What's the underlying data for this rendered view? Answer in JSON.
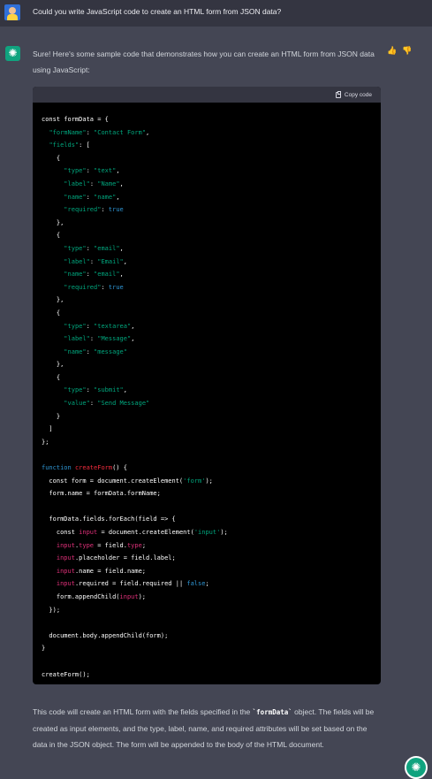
{
  "user": {
    "message": "Could you write JavaScript code to create an HTML form from JSON data?"
  },
  "assistant": {
    "intro": "Sure! Here's some sample code that demonstrates how you can create an HTML form from JSON data using JavaScript:",
    "copy_label": "Copy code",
    "outro_before": "This code will create an HTML form with the fields specified in the ",
    "outro_code": "`formData`",
    "outro_after": " object. The fields will be created as input elements, and the type, label, name, and required attributes will be set based on the data in the JSON object. The form will be appended to the body of the HTML document."
  },
  "code_lines": [
    [
      [
        "t",
        "const formData = {"
      ]
    ],
    [
      [
        "t",
        "  "
      ],
      [
        "s",
        "\"formName\""
      ],
      [
        "t",
        ": "
      ],
      [
        "s",
        "\"Contact Form\""
      ],
      [
        "t",
        ","
      ]
    ],
    [
      [
        "t",
        "  "
      ],
      [
        "s",
        "\"fields\""
      ],
      [
        "t",
        ": ["
      ]
    ],
    [
      [
        "t",
        "    {"
      ]
    ],
    [
      [
        "t",
        "      "
      ],
      [
        "s",
        "\"type\""
      ],
      [
        "t",
        ": "
      ],
      [
        "s",
        "\"text\""
      ],
      [
        "t",
        ","
      ]
    ],
    [
      [
        "t",
        "      "
      ],
      [
        "s",
        "\"label\""
      ],
      [
        "t",
        ": "
      ],
      [
        "s",
        "\"Name\""
      ],
      [
        "t",
        ","
      ]
    ],
    [
      [
        "t",
        "      "
      ],
      [
        "s",
        "\"name\""
      ],
      [
        "t",
        ": "
      ],
      [
        "s",
        "\"name\""
      ],
      [
        "t",
        ","
      ]
    ],
    [
      [
        "t",
        "      "
      ],
      [
        "s",
        "\"required\""
      ],
      [
        "t",
        ": "
      ],
      [
        "k",
        "true"
      ]
    ],
    [
      [
        "t",
        "    },"
      ]
    ],
    [
      [
        "t",
        "    {"
      ]
    ],
    [
      [
        "t",
        "      "
      ],
      [
        "s",
        "\"type\""
      ],
      [
        "t",
        ": "
      ],
      [
        "s",
        "\"email\""
      ],
      [
        "t",
        ","
      ]
    ],
    [
      [
        "t",
        "      "
      ],
      [
        "s",
        "\"label\""
      ],
      [
        "t",
        ": "
      ],
      [
        "s",
        "\"Email\""
      ],
      [
        "t",
        ","
      ]
    ],
    [
      [
        "t",
        "      "
      ],
      [
        "s",
        "\"name\""
      ],
      [
        "t",
        ": "
      ],
      [
        "s",
        "\"email\""
      ],
      [
        "t",
        ","
      ]
    ],
    [
      [
        "t",
        "      "
      ],
      [
        "s",
        "\"required\""
      ],
      [
        "t",
        ": "
      ],
      [
        "k",
        "true"
      ]
    ],
    [
      [
        "t",
        "    },"
      ]
    ],
    [
      [
        "t",
        "    {"
      ]
    ],
    [
      [
        "t",
        "      "
      ],
      [
        "s",
        "\"type\""
      ],
      [
        "t",
        ": "
      ],
      [
        "s",
        "\"textarea\""
      ],
      [
        "t",
        ","
      ]
    ],
    [
      [
        "t",
        "      "
      ],
      [
        "s",
        "\"label\""
      ],
      [
        "t",
        ": "
      ],
      [
        "s",
        "\"Message\""
      ],
      [
        "t",
        ","
      ]
    ],
    [
      [
        "t",
        "      "
      ],
      [
        "s",
        "\"name\""
      ],
      [
        "t",
        ": "
      ],
      [
        "s",
        "\"message\""
      ]
    ],
    [
      [
        "t",
        "    },"
      ]
    ],
    [
      [
        "t",
        "    {"
      ]
    ],
    [
      [
        "t",
        "      "
      ],
      [
        "s",
        "\"type\""
      ],
      [
        "t",
        ": "
      ],
      [
        "s",
        "\"submit\""
      ],
      [
        "t",
        ","
      ]
    ],
    [
      [
        "t",
        "      "
      ],
      [
        "s",
        "\"value\""
      ],
      [
        "t",
        ": "
      ],
      [
        "s",
        "\"Send Message\""
      ]
    ],
    [
      [
        "t",
        "    }"
      ]
    ],
    [
      [
        "t",
        "  ]"
      ]
    ],
    [
      [
        "t",
        "};"
      ]
    ],
    [
      [
        "t",
        ""
      ]
    ],
    [
      [
        "k",
        "function"
      ],
      [
        "t",
        " "
      ],
      [
        "f",
        "createForm"
      ],
      [
        "t",
        "() {"
      ]
    ],
    [
      [
        "t",
        "  const form = document.createElement("
      ],
      [
        "s",
        "'form'"
      ],
      [
        "t",
        ");"
      ]
    ],
    [
      [
        "t",
        "  form.name = formData.formName;"
      ]
    ],
    [
      [
        "t",
        ""
      ]
    ],
    [
      [
        "t",
        "  formData.fields.forEach(field => {"
      ]
    ],
    [
      [
        "t",
        "    const "
      ],
      [
        "v",
        "input"
      ],
      [
        "t",
        " = document.createElement("
      ],
      [
        "s",
        "'input'"
      ],
      [
        "t",
        ");"
      ]
    ],
    [
      [
        "t",
        "    "
      ],
      [
        "v",
        "input"
      ],
      [
        "t",
        "."
      ],
      [
        "v",
        "type"
      ],
      [
        "t",
        " = field."
      ],
      [
        "v",
        "type"
      ],
      [
        "t",
        ";"
      ]
    ],
    [
      [
        "t",
        "    "
      ],
      [
        "v",
        "input"
      ],
      [
        "t",
        ".placeholder = field.label;"
      ]
    ],
    [
      [
        "t",
        "    "
      ],
      [
        "v",
        "input"
      ],
      [
        "t",
        ".name = field.name;"
      ]
    ],
    [
      [
        "t",
        "    "
      ],
      [
        "v",
        "input"
      ],
      [
        "t",
        ".required = field.required || "
      ],
      [
        "k",
        "false"
      ],
      [
        "t",
        ";"
      ]
    ],
    [
      [
        "t",
        "    form.appendChild("
      ],
      [
        "v",
        "input"
      ],
      [
        "t",
        ");"
      ]
    ],
    [
      [
        "t",
        "  });"
      ]
    ],
    [
      [
        "t",
        ""
      ]
    ],
    [
      [
        "t",
        "  document.body.appendChild(form);"
      ]
    ],
    [
      [
        "t",
        "}"
      ]
    ],
    [
      [
        "t",
        ""
      ]
    ],
    [
      [
        "t",
        "createForm();"
      ]
    ]
  ]
}
